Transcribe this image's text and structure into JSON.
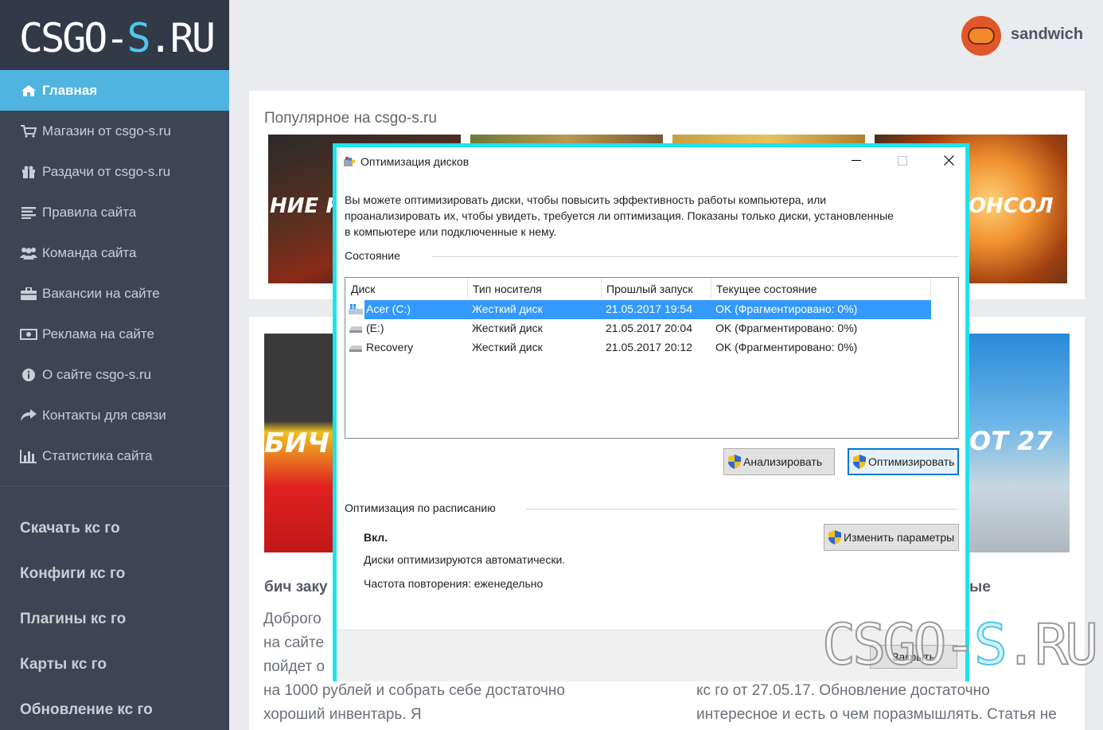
{
  "site": {
    "logo_main": "CSGO-",
    "logo_accent": "S",
    "logo_end": ".RU",
    "accent_color": "#4fb5e0"
  },
  "sidebar": {
    "items": [
      {
        "label": "Главная",
        "icon": "home-icon",
        "active": true
      },
      {
        "label": "Магазин от csgo-s.ru",
        "icon": "cart-icon"
      },
      {
        "label": "Раздачи от csgo-s.ru",
        "icon": "gift-icon"
      },
      {
        "label": "Правила сайта",
        "icon": "list-icon"
      },
      {
        "label": "Команда сайта",
        "icon": "users-icon"
      },
      {
        "label": "Вакансии на сайте",
        "icon": "briefcase-icon"
      },
      {
        "label": "Реклама на сайте",
        "icon": "money-icon"
      },
      {
        "label": "О сайте csgo-s.ru",
        "icon": "info-icon"
      },
      {
        "label": "Контакты для связи",
        "icon": "share-icon"
      },
      {
        "label": "Статистика сайта",
        "icon": "bar-chart-icon"
      }
    ],
    "big_items": [
      {
        "label": "Скачать кс го"
      },
      {
        "label": "Конфиги кс го"
      },
      {
        "label": "Плагины кс го"
      },
      {
        "label": "Карты кс го"
      },
      {
        "label": "Обновление кс го"
      }
    ]
  },
  "header": {
    "username": "sandwich",
    "avatar_icon": "burger-avatar"
  },
  "popular": {
    "title": "Популярное на csgo-s.ru",
    "thumbs": [
      {
        "text": "НИЕ К"
      },
      {
        "text": ""
      },
      {
        "text": ""
      },
      {
        "text": "ОНСОЛ"
      }
    ]
  },
  "articles": [
    {
      "thumb_text": "БИЧ",
      "title": "бич заку",
      "lines": [
        "Доброго",
        "на сайте",
        "пойдет о",
        "на 1000 рублей и собрать себе достаточно",
        "хороший инвентарь. Я"
      ]
    },
    {
      "thumb_text": "ОТ 27",
      "title": "ые",
      "lines": [
        "кс го от 27.05.17. Обновление достаточно",
        "интересное и есть о чем поразмышлять. Статья не"
      ]
    }
  ],
  "dialog": {
    "title": "Оптимизация дисков",
    "description": "Вы можете оптимизировать диски, чтобы повысить эффективность работы  компьютера, или проанализировать их, чтобы увидеть, требуется ли оптимизация. Показаны только диски, установленные в компьютере или подключенные к нему.",
    "status_label": "Состояние",
    "columns": [
      "Диск",
      "Тип носителя",
      "Прошлый запуск",
      "Текущее состояние"
    ],
    "rows": [
      {
        "disk": "Acer (C:)",
        "type": "Жесткий диск",
        "last_run": "21.05.2017 19:54",
        "status": "OK (Фрагментировано: 0%)",
        "selected": true,
        "icon": "windows-drive-icon"
      },
      {
        "disk": "(E:)",
        "type": "Жесткий диск",
        "last_run": "21.05.2017 20:04",
        "status": "OK (Фрагментировано: 0%)",
        "selected": false,
        "icon": "drive-icon"
      },
      {
        "disk": "Recovery",
        "type": "Жесткий диск",
        "last_run": "21.05.2017 20:12",
        "status": "OK (Фрагментировано: 0%)",
        "selected": false,
        "icon": "drive-icon"
      }
    ],
    "analyze_label": "Анализировать",
    "optimize_label": "Оптимизировать",
    "schedule_label": "Оптимизация по расписанию",
    "schedule_state": "Вкл.",
    "schedule_desc": "Диски оптимизируются автоматически.",
    "schedule_freq": "Частота повторения: еженедельно",
    "change_params_label": "Изменить параметры",
    "close_label": "Закрыть"
  },
  "watermark": {
    "text_main": "CSGO-",
    "text_accent": "S",
    "text_end": ".RU"
  }
}
